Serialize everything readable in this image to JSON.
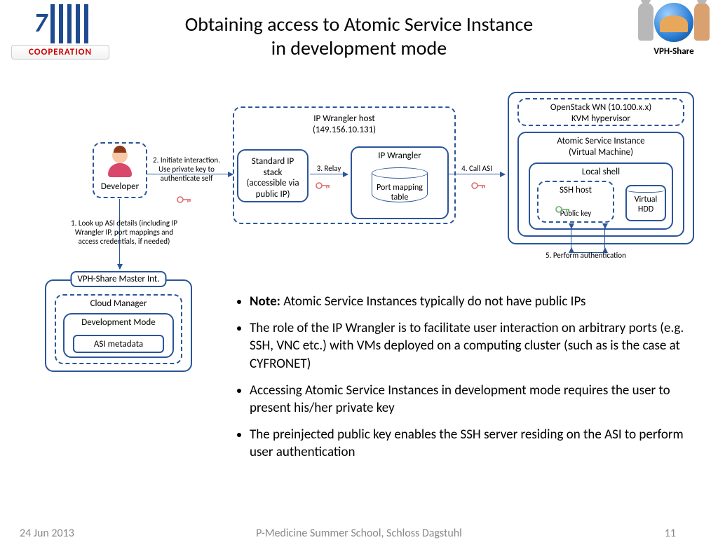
{
  "title_line1": "Obtaining access to Atomic Service Instance",
  "title_line2": "in development mode",
  "logo_left_band": "COOPERATION",
  "logo_right_label": "VPH-Share",
  "developer_label": "Developer",
  "wrangler_host_label": "IP Wrangler host\n(149.156.10.131)",
  "ip_stack_label": "Standard IP stack (accessible via public IP)",
  "ip_wrangler_label": "IP Wrangler",
  "port_mapping_label": "Port mapping table",
  "openstack_label": "OpenStack WN (10.100.x.x)\nKVM hypervisor",
  "asi_label": "Atomic Service Instance\n(Virtual Machine)",
  "local_shell_label": "Local shell",
  "ssh_host_label": "SSH host",
  "public_key_label": "Public key",
  "virtual_hdd_label": "Virtual HDD",
  "master_int_label": "VPH-Share Master Int.",
  "cloud_manager_label": "Cloud Manager",
  "dev_mode_label": "Development Mode",
  "asi_metadata_label": "ASI metadata",
  "step1": "1. Look up ASI details (including IP Wrangler IP, port mappings and access credentials, if needed)",
  "step2": "2. Initiate interaction. Use private key to authenticate self",
  "step3": "3. Relay",
  "step4": "4. Call ASI",
  "step5": "5. Perform authentication",
  "bullets": [
    {
      "b": "Note:",
      "t": " Atomic Service Instances typically do not have public IPs"
    },
    {
      "b": "",
      "t": "The role of the IP Wrangler is to facilitate user interaction on arbitrary ports (e.g. SSH, VNC etc.) with VMs deployed on a computing cluster (such as is the case at CYFRONET)"
    },
    {
      "b": "",
      "t": "Accessing Atomic Service Instances in development mode requires the user to present his/her private key"
    },
    {
      "b": "",
      "t": "The preinjected public key enables the SSH server residing on the ASI to perform user authentication"
    }
  ],
  "footer_date": "24 Jun 2013",
  "footer_mid": "P-Medicine Summer School, Schloss Dagstuhl",
  "footer_page": "11"
}
